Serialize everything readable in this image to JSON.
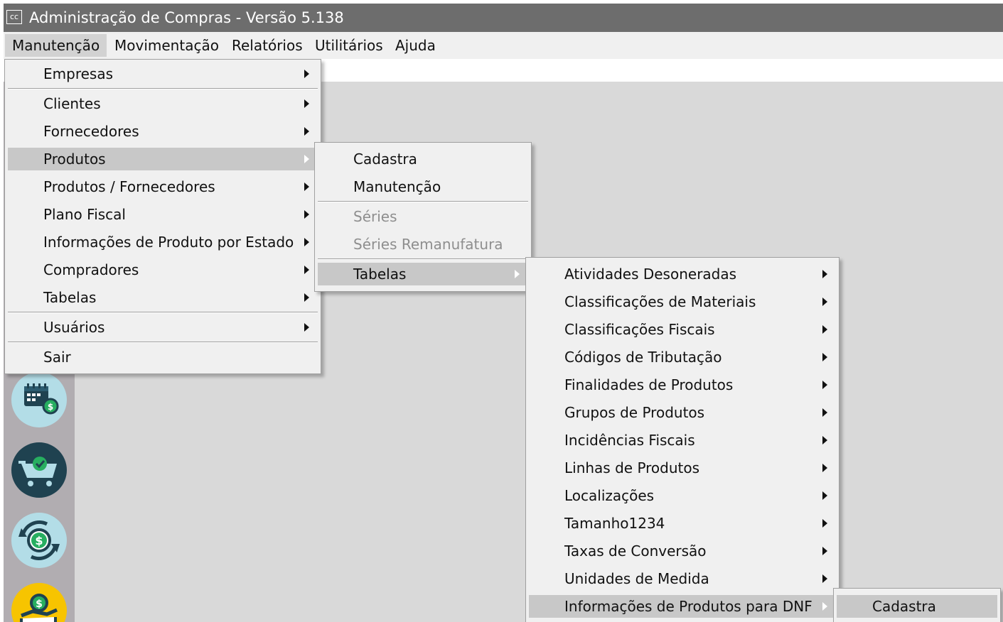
{
  "window": {
    "icon_text": "cc",
    "title": "Administração de Compras - Versão 5.138"
  },
  "menubar": {
    "items": [
      {
        "label": "Manutenção"
      },
      {
        "label": "Movimentação"
      },
      {
        "label": "Relatórios"
      },
      {
        "label": "Utilitários"
      },
      {
        "label": "Ajuda"
      }
    ]
  },
  "menu_manutencao": {
    "items": [
      {
        "label": "Empresas"
      },
      {
        "label": "Clientes"
      },
      {
        "label": "Fornecedores"
      },
      {
        "label": "Produtos"
      },
      {
        "label": "Produtos / Fornecedores"
      },
      {
        "label": "Plano Fiscal"
      },
      {
        "label": "Informações de Produto por Estado"
      },
      {
        "label": "Compradores"
      },
      {
        "label": "Tabelas"
      },
      {
        "label": "Usuários"
      },
      {
        "label": "Sair"
      }
    ]
  },
  "menu_produtos": {
    "items": [
      {
        "label": "Cadastra"
      },
      {
        "label": "Manutenção"
      },
      {
        "label": "Séries"
      },
      {
        "label": "Séries Remanufatura"
      },
      {
        "label": "Tabelas"
      }
    ]
  },
  "menu_tabelas": {
    "items": [
      {
        "label": "Atividades Desoneradas"
      },
      {
        "label": "Classificações de Materiais"
      },
      {
        "label": "Classificações Fiscais"
      },
      {
        "label": "Códigos de Tributação"
      },
      {
        "label": "Finalidades de Produtos"
      },
      {
        "label": "Grupos de Produtos"
      },
      {
        "label": "Incidências Fiscais"
      },
      {
        "label": "Linhas de Produtos"
      },
      {
        "label": "Localizações"
      },
      {
        "label": "Tamanho1234"
      },
      {
        "label": "Taxas de Conversão"
      },
      {
        "label": "Unidades de Medida"
      },
      {
        "label": "Informações de Produtos para DNF"
      }
    ]
  },
  "menu_dnf": {
    "items": [
      {
        "label": "Cadastra"
      }
    ]
  },
  "colors": {
    "titlebar": "#6d6d6d",
    "menu_bg": "#f0f0f0",
    "selected_bg": "#c8c8c8",
    "disabled_text": "#8e8e8e",
    "sidebar": "#b1adb1",
    "icon_bg": "#b3dde7",
    "icon_dark": "#1f4250",
    "icon_green": "#27ae60",
    "icon_yellow": "#f7c400"
  },
  "sidebar_icons": [
    {
      "name": "calendar-money-icon"
    },
    {
      "name": "shopping-cart-check-icon"
    },
    {
      "name": "money-exchange-icon"
    },
    {
      "name": "money-hand-icon"
    }
  ]
}
